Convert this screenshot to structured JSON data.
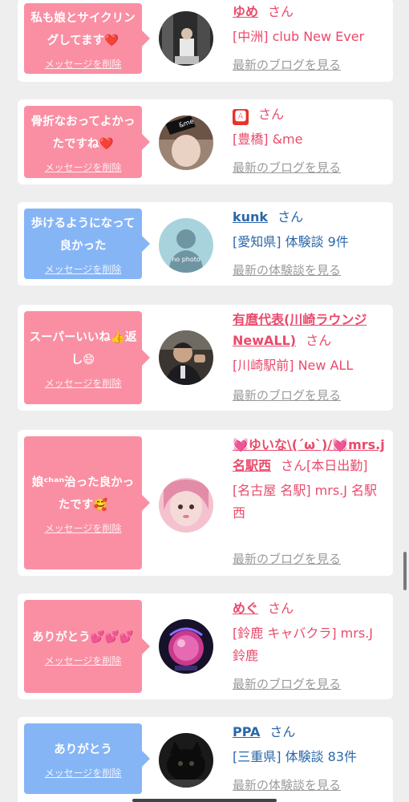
{
  "delete_label": "メッセージを削除",
  "honorific": "さん",
  "colors": {
    "pink": "#fa8fa3",
    "blue": "#86b5f6",
    "name_pink": "#e94a6b",
    "name_blue": "#2a67a9"
  },
  "cards": [
    {
      "message": "私も娘とサイクリングしてます❤️",
      "name": "ゆめ",
      "detail": "[中洲] club New Ever",
      "link": "最新のブログを見る",
      "avatar": "avatar-photo-woman-mirror"
    },
    {
      "message": "骨折なおってよかったですね❤️",
      "name": "🅰",
      "detail": "[豊橋] &me",
      "link": "最新のブログを見る",
      "avatar": "avatar-photo-woman-andme"
    },
    {
      "message": "歩けるようになって良かった",
      "name": "kunk",
      "detail": "[愛知県] 体験談 9件",
      "link": "最新の体験談を見る",
      "avatar": "avatar-no-photo",
      "avatar_text": "no photo"
    },
    {
      "message": "スーパーいいね👍返し😄",
      "name": "有麿代表(川崎ラウンジNewALL)",
      "detail": "[川崎駅前] New ALL",
      "link": "最新のブログを見る",
      "avatar": "avatar-photo-man-suit"
    },
    {
      "message": "娘ᶜʰᵃⁿ治った良かったです🥰",
      "name": "💓ゆいな\\(´ω`)/💓mrs.j名駅西",
      "name_suffix": "さん[本日出勤]",
      "detail": "[名古屋 名駅] mrs.J 名駅西",
      "link": "最新のブログを見る",
      "avatar": "avatar-photo-woman-pink"
    },
    {
      "message": "ありがとう💕💕💕",
      "name": "めぐ",
      "detail": "[鈴鹿 キャバクラ] mrs.J 鈴鹿",
      "link": "最新のブログを見る",
      "avatar": "avatar-photo-flower-sphere"
    },
    {
      "message": "ありがとう",
      "name": "PPA",
      "detail": "[三重県] 体験談 83件",
      "link": "最新の体験談を見る",
      "avatar": "avatar-photo-black-cat"
    }
  ]
}
